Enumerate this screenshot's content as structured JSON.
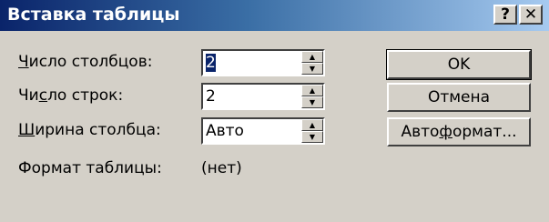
{
  "window": {
    "title": "Вставка таблицы",
    "help_glyph": "?",
    "close_glyph": "✕"
  },
  "fields": {
    "columns": {
      "label_pre": "",
      "label_key": "Ч",
      "label_post": "исло столбцов:",
      "value": "2"
    },
    "rows": {
      "label_pre": "Чи",
      "label_key": "с",
      "label_post": "ло строк:",
      "value": "2"
    },
    "width": {
      "label_pre": "",
      "label_key": "Ш",
      "label_post": "ирина столбца:",
      "value": "Авто"
    }
  },
  "format": {
    "label": "Формат таблицы:",
    "value": "(нет)"
  },
  "buttons": {
    "ok": "OK",
    "cancel": "Отмена",
    "autoformat_pre": "Авто",
    "autoformat_key": "ф",
    "autoformat_post": "ормат..."
  },
  "icons": {
    "spin_up": "▲",
    "spin_down": "▼"
  }
}
